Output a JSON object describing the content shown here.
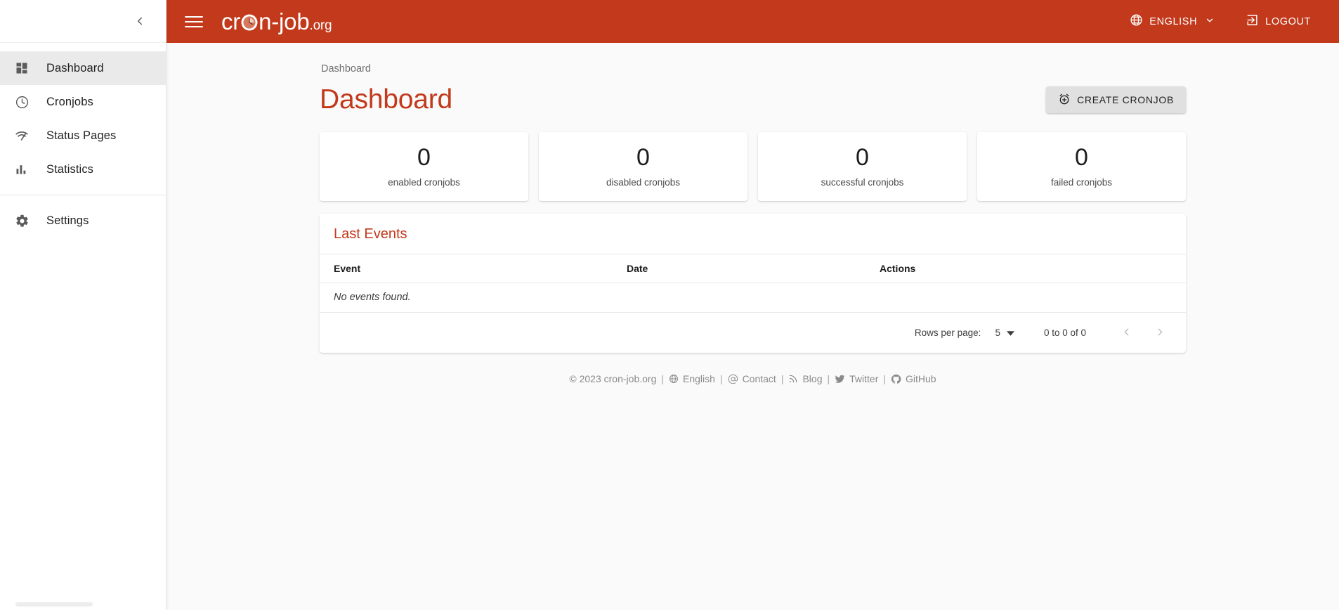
{
  "topbar": {
    "menu_icon": "hamburger-icon",
    "brand_main": "cron-job",
    "brand_tld": ".org",
    "language_label": "ENGLISH",
    "language_icon": "globe-icon",
    "language_chevron": "chevron-down-icon",
    "logout_label": "LOGOUT",
    "logout_icon": "logout-icon",
    "background_color": "#c2391b"
  },
  "sidebar": {
    "collapse_icon": "chevron-left-icon",
    "items": [
      {
        "label": "Dashboard",
        "icon": "dashboard-grid-icon",
        "active": true
      },
      {
        "label": "Cronjobs",
        "icon": "clock-icon",
        "active": false
      },
      {
        "label": "Status Pages",
        "icon": "pulse-wifi-icon",
        "active": false
      },
      {
        "label": "Statistics",
        "icon": "bar-chart-icon",
        "active": false
      }
    ],
    "settings": {
      "label": "Settings",
      "icon": "gear-icon"
    }
  },
  "page": {
    "breadcrumb": "Dashboard",
    "title": "Dashboard",
    "title_color": "#c2391b",
    "create_button": {
      "label": "CREATE CRONJOB",
      "icon": "alarm-plus-icon"
    }
  },
  "stats": [
    {
      "value": "0",
      "label": "enabled cronjobs"
    },
    {
      "value": "0",
      "label": "disabled cronjobs"
    },
    {
      "value": "0",
      "label": "successful cronjobs"
    },
    {
      "value": "0",
      "label": "failed cronjobs"
    }
  ],
  "events_panel": {
    "title": "Last Events",
    "columns": [
      "Event",
      "Date",
      "Actions"
    ],
    "empty_message": "No events found.",
    "rows": [],
    "paginator": {
      "rows_per_page_label": "Rows per page:",
      "rows_per_page_value": "5",
      "rows_per_page_chevron": "chevron-down-icon",
      "range_label": "0 to 0 of 0",
      "prev_icon": "chevron-left-icon",
      "next_icon": "chevron-right-icon"
    }
  },
  "footer": {
    "copyright": "© 2023 cron-job.org",
    "links": [
      {
        "label": "English",
        "icon": "globe-icon"
      },
      {
        "label": "Contact",
        "icon": "at-icon"
      },
      {
        "label": "Blog",
        "icon": "rss-icon"
      },
      {
        "label": "Twitter",
        "icon": "twitter-icon"
      },
      {
        "label": "GitHub",
        "icon": "github-icon"
      }
    ],
    "separator": "|"
  }
}
